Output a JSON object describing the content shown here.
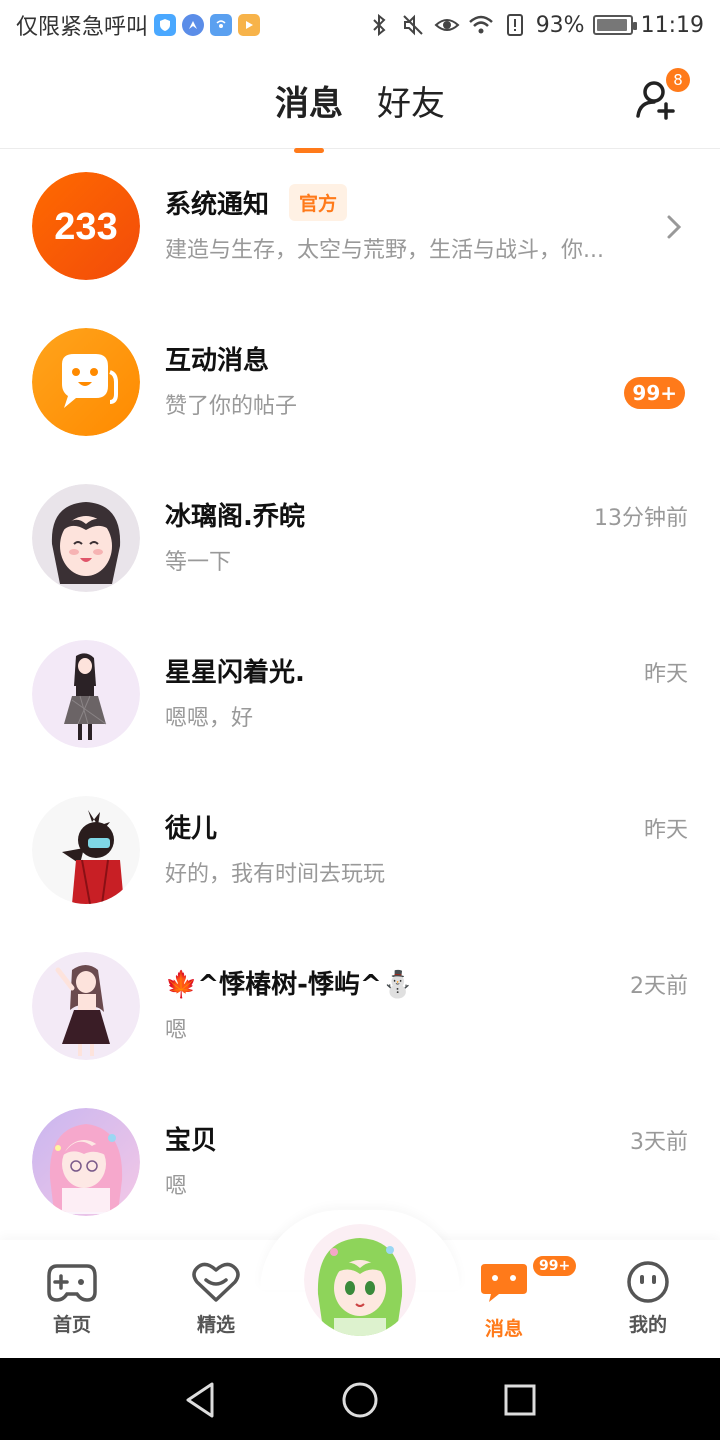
{
  "status_bar": {
    "carrier_text": "仅限紧急呼叫",
    "battery_percent": "93%",
    "battery_level": 0.93,
    "time": "11:19",
    "apps": [
      {
        "icon": "shield-app-icon",
        "color": "#4aa8ff"
      },
      {
        "icon": "compass-app-icon",
        "color": "#5b8de8"
      },
      {
        "icon": "signal-app-icon",
        "color": "#5aa0f0"
      },
      {
        "icon": "play-app-icon",
        "color": "#f7b34a"
      }
    ],
    "right_icons": [
      "bluetooth-icon",
      "mute-icon",
      "eye-icon",
      "wifi-icon",
      "alert-icon"
    ]
  },
  "header": {
    "tabs": [
      {
        "label": "消息",
        "active": true
      },
      {
        "label": "好友",
        "active": false
      }
    ],
    "add_friend_badge": "8"
  },
  "messages": [
    {
      "name": "系统通知",
      "tag": "官方",
      "preview": "建造与生存，太空与荒野，生活与战斗，你...",
      "time": "",
      "badge": "",
      "avatar": "logo-233-avatar",
      "has_chevron": true
    },
    {
      "name": "互动消息",
      "tag": "",
      "preview": "赞了你的帖子",
      "time": "",
      "badge": "99+",
      "avatar": "interaction-avatar",
      "has_chevron": false
    },
    {
      "name": "冰璃阁.乔皖",
      "tag": "",
      "preview": "等一下",
      "time": "13分钟前",
      "badge": "",
      "avatar": "user-avatar",
      "has_chevron": false
    },
    {
      "name": "星星闪着光.",
      "tag": "",
      "preview": "嗯嗯，好",
      "time": "昨天",
      "badge": "",
      "avatar": "user-avatar",
      "has_chevron": false
    },
    {
      "name": "徒儿",
      "tag": "",
      "preview": "好的，我有时间去玩玩",
      "time": "昨天",
      "badge": "",
      "avatar": "user-avatar",
      "has_chevron": false
    },
    {
      "name": "🍁^悸椿树-悸屿^⛄",
      "tag": "",
      "preview": "嗯",
      "time": "2天前",
      "badge": "",
      "avatar": "user-avatar",
      "has_chevron": false
    },
    {
      "name": "宝贝",
      "tag": "",
      "preview": "嗯",
      "time": "3天前",
      "badge": "",
      "avatar": "user-avatar",
      "has_chevron": false
    }
  ],
  "bottom_nav": {
    "items": [
      {
        "label": "首页",
        "icon": "gamepad-icon",
        "active": false
      },
      {
        "label": "精选",
        "icon": "heart-icon",
        "active": false
      },
      {
        "label": "消息",
        "icon": "chat-icon",
        "active": true,
        "badge": "99+"
      },
      {
        "label": "我的",
        "icon": "face-icon",
        "active": false
      }
    ]
  },
  "colors": {
    "accent": "#ff7a1a",
    "text_primary": "#111111",
    "text_secondary": "#999999"
  }
}
